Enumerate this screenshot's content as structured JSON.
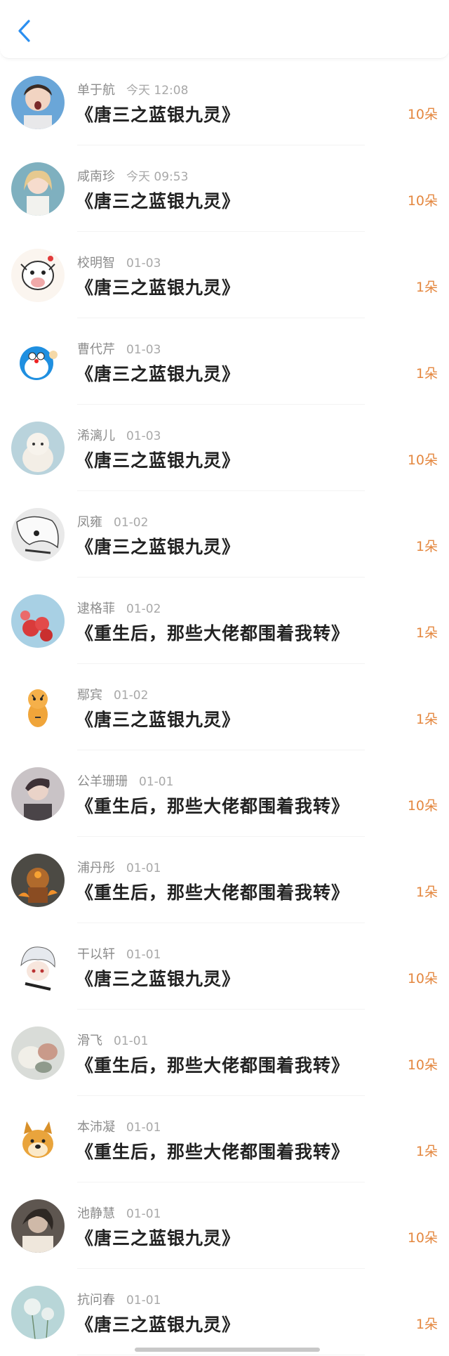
{
  "header": {
    "back_icon": "chevron-left-icon",
    "accent": "#2b8ff0"
  },
  "items": [
    {
      "name": "单于航",
      "time": "今天 12:08",
      "book": "《唐三之蓝银九灵》",
      "count": "10朵",
      "avatar": "boy-photo"
    },
    {
      "name": "咸南珍",
      "time": "今天 09:53",
      "book": "《唐三之蓝银九灵》",
      "count": "10朵",
      "avatar": "girl-photo"
    },
    {
      "name": "校明智",
      "time": "01-03",
      "book": "《唐三之蓝银九灵》",
      "count": "1朵",
      "avatar": "cartoon-cow"
    },
    {
      "name": "曹代芹",
      "time": "01-03",
      "book": "《唐三之蓝银九灵》",
      "count": "1朵",
      "avatar": "doraemon"
    },
    {
      "name": "浠漓儿",
      "time": "01-03",
      "book": "《唐三之蓝银九灵》",
      "count": "10朵",
      "avatar": "plush-toy"
    },
    {
      "name": "凤雍",
      "time": "01-02",
      "book": "《唐三之蓝银九灵》",
      "count": "1朵",
      "avatar": "anime-sketch"
    },
    {
      "name": "逮格菲",
      "time": "01-02",
      "book": "《重生后，那些大佬都围着我转》",
      "count": "1朵",
      "avatar": "red-balloons"
    },
    {
      "name": "鄢宾",
      "time": "01-02",
      "book": "《唐三之蓝银九灵》",
      "count": "1朵",
      "avatar": "cartoon-tiger"
    },
    {
      "name": "公羊珊珊",
      "time": "01-01",
      "book": "《重生后，那些大佬都围着我转》",
      "count": "10朵",
      "avatar": "man-photo"
    },
    {
      "name": "浦丹彤",
      "time": "01-01",
      "book": "《重生后，那些大佬都围着我转》",
      "count": "1朵",
      "avatar": "robot-fire"
    },
    {
      "name": "干以轩",
      "time": "01-01",
      "book": "《唐三之蓝银九灵》",
      "count": "10朵",
      "avatar": "anime-boy"
    },
    {
      "name": "滑飞",
      "time": "01-01",
      "book": "《重生后，那些大佬都围着我转》",
      "count": "10朵",
      "avatar": "food-photo"
    },
    {
      "name": "本沛凝",
      "time": "01-01",
      "book": "《重生后，那些大佬都围着我转》",
      "count": "1朵",
      "avatar": "doge"
    },
    {
      "name": "池静慧",
      "time": "01-01",
      "book": "《唐三之蓝银九灵》",
      "count": "10朵",
      "avatar": "dark-photo"
    },
    {
      "name": "抗问春",
      "time": "01-01",
      "book": "《唐三之蓝银九灵》",
      "count": "1朵",
      "avatar": "dandelion"
    }
  ]
}
